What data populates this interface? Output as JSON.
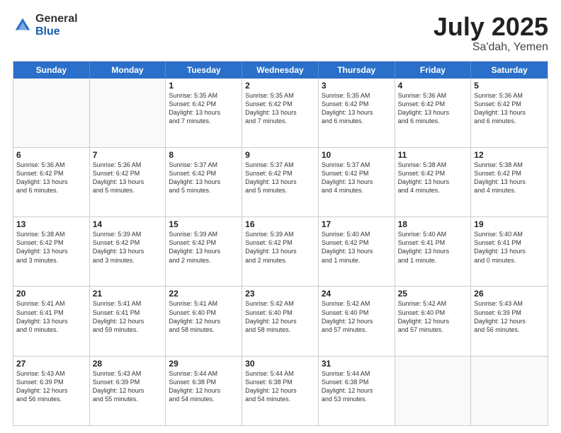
{
  "logo": {
    "general": "General",
    "blue": "Blue"
  },
  "title": {
    "month": "July 2025",
    "location": "Sa'dah, Yemen"
  },
  "header_days": [
    "Sunday",
    "Monday",
    "Tuesday",
    "Wednesday",
    "Thursday",
    "Friday",
    "Saturday"
  ],
  "weeks": [
    [
      {
        "day": "",
        "info": ""
      },
      {
        "day": "",
        "info": ""
      },
      {
        "day": "1",
        "info": "Sunrise: 5:35 AM\nSunset: 6:42 PM\nDaylight: 13 hours\nand 7 minutes."
      },
      {
        "day": "2",
        "info": "Sunrise: 5:35 AM\nSunset: 6:42 PM\nDaylight: 13 hours\nand 7 minutes."
      },
      {
        "day": "3",
        "info": "Sunrise: 5:35 AM\nSunset: 6:42 PM\nDaylight: 13 hours\nand 6 minutes."
      },
      {
        "day": "4",
        "info": "Sunrise: 5:36 AM\nSunset: 6:42 PM\nDaylight: 13 hours\nand 6 minutes."
      },
      {
        "day": "5",
        "info": "Sunrise: 5:36 AM\nSunset: 6:42 PM\nDaylight: 13 hours\nand 6 minutes."
      }
    ],
    [
      {
        "day": "6",
        "info": "Sunrise: 5:36 AM\nSunset: 6:42 PM\nDaylight: 13 hours\nand 6 minutes."
      },
      {
        "day": "7",
        "info": "Sunrise: 5:36 AM\nSunset: 6:42 PM\nDaylight: 13 hours\nand 5 minutes."
      },
      {
        "day": "8",
        "info": "Sunrise: 5:37 AM\nSunset: 6:42 PM\nDaylight: 13 hours\nand 5 minutes."
      },
      {
        "day": "9",
        "info": "Sunrise: 5:37 AM\nSunset: 6:42 PM\nDaylight: 13 hours\nand 5 minutes."
      },
      {
        "day": "10",
        "info": "Sunrise: 5:37 AM\nSunset: 6:42 PM\nDaylight: 13 hours\nand 4 minutes."
      },
      {
        "day": "11",
        "info": "Sunrise: 5:38 AM\nSunset: 6:42 PM\nDaylight: 13 hours\nand 4 minutes."
      },
      {
        "day": "12",
        "info": "Sunrise: 5:38 AM\nSunset: 6:42 PM\nDaylight: 13 hours\nand 4 minutes."
      }
    ],
    [
      {
        "day": "13",
        "info": "Sunrise: 5:38 AM\nSunset: 6:42 PM\nDaylight: 13 hours\nand 3 minutes."
      },
      {
        "day": "14",
        "info": "Sunrise: 5:39 AM\nSunset: 6:42 PM\nDaylight: 13 hours\nand 3 minutes."
      },
      {
        "day": "15",
        "info": "Sunrise: 5:39 AM\nSunset: 6:42 PM\nDaylight: 13 hours\nand 2 minutes."
      },
      {
        "day": "16",
        "info": "Sunrise: 5:39 AM\nSunset: 6:42 PM\nDaylight: 13 hours\nand 2 minutes."
      },
      {
        "day": "17",
        "info": "Sunrise: 5:40 AM\nSunset: 6:42 PM\nDaylight: 13 hours\nand 1 minute."
      },
      {
        "day": "18",
        "info": "Sunrise: 5:40 AM\nSunset: 6:41 PM\nDaylight: 13 hours\nand 1 minute."
      },
      {
        "day": "19",
        "info": "Sunrise: 5:40 AM\nSunset: 6:41 PM\nDaylight: 13 hours\nand 0 minutes."
      }
    ],
    [
      {
        "day": "20",
        "info": "Sunrise: 5:41 AM\nSunset: 6:41 PM\nDaylight: 13 hours\nand 0 minutes."
      },
      {
        "day": "21",
        "info": "Sunrise: 5:41 AM\nSunset: 6:41 PM\nDaylight: 12 hours\nand 59 minutes."
      },
      {
        "day": "22",
        "info": "Sunrise: 5:41 AM\nSunset: 6:40 PM\nDaylight: 12 hours\nand 58 minutes."
      },
      {
        "day": "23",
        "info": "Sunrise: 5:42 AM\nSunset: 6:40 PM\nDaylight: 12 hours\nand 58 minutes."
      },
      {
        "day": "24",
        "info": "Sunrise: 5:42 AM\nSunset: 6:40 PM\nDaylight: 12 hours\nand 57 minutes."
      },
      {
        "day": "25",
        "info": "Sunrise: 5:42 AM\nSunset: 6:40 PM\nDaylight: 12 hours\nand 57 minutes."
      },
      {
        "day": "26",
        "info": "Sunrise: 5:43 AM\nSunset: 6:39 PM\nDaylight: 12 hours\nand 56 minutes."
      }
    ],
    [
      {
        "day": "27",
        "info": "Sunrise: 5:43 AM\nSunset: 6:39 PM\nDaylight: 12 hours\nand 56 minutes."
      },
      {
        "day": "28",
        "info": "Sunrise: 5:43 AM\nSunset: 6:39 PM\nDaylight: 12 hours\nand 55 minutes."
      },
      {
        "day": "29",
        "info": "Sunrise: 5:44 AM\nSunset: 6:38 PM\nDaylight: 12 hours\nand 54 minutes."
      },
      {
        "day": "30",
        "info": "Sunrise: 5:44 AM\nSunset: 6:38 PM\nDaylight: 12 hours\nand 54 minutes."
      },
      {
        "day": "31",
        "info": "Sunrise: 5:44 AM\nSunset: 6:38 PM\nDaylight: 12 hours\nand 53 minutes."
      },
      {
        "day": "",
        "info": ""
      },
      {
        "day": "",
        "info": ""
      }
    ]
  ]
}
